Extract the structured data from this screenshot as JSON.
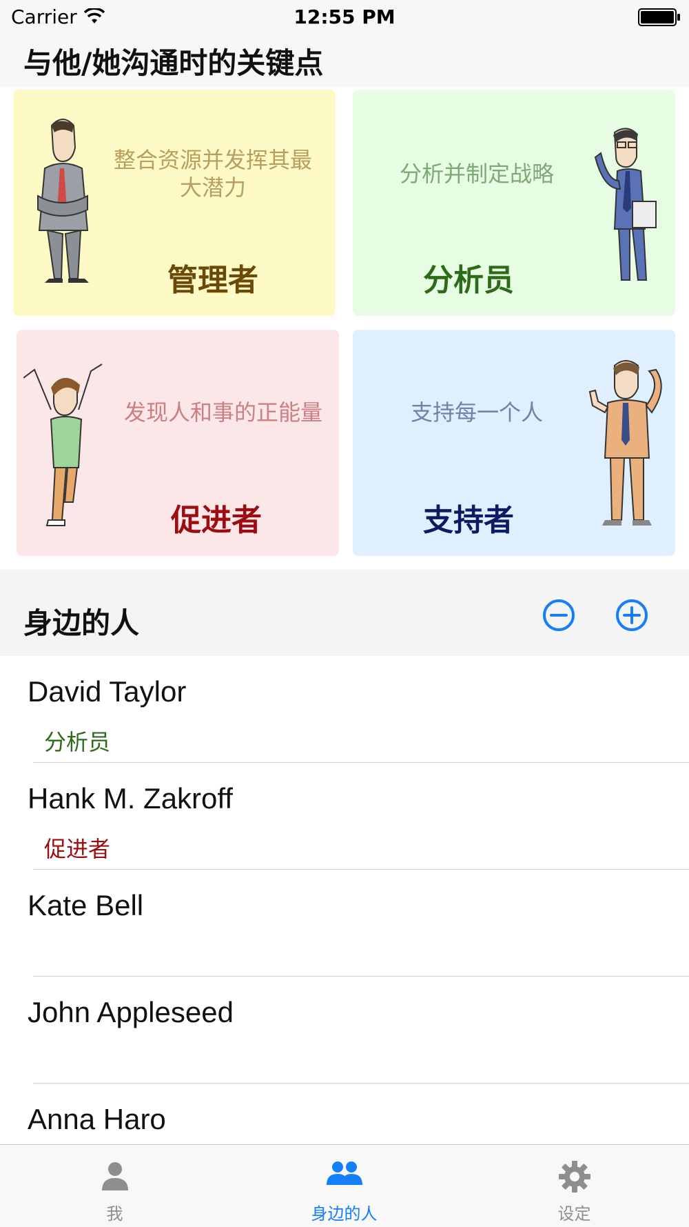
{
  "status_bar": {
    "carrier": "Carrier",
    "time": "12:55 PM"
  },
  "header": {
    "title": "与他/她沟通时的关键点"
  },
  "cards": [
    {
      "title": "管理者",
      "description": "整合资源并发挥其最大潜力",
      "bg": "#fdfac6",
      "title_color": "#6b4a07",
      "desc_color": "#b79f5f"
    },
    {
      "title": "分析员",
      "description": "分析并制定战略",
      "bg": "#e6fde3",
      "title_color": "#2f6a1a",
      "desc_color": "#7fa777"
    },
    {
      "title": "促进者",
      "description": "发现人和事的正能量",
      "bg": "#fbe7e8",
      "title_color": "#9c0d12",
      "desc_color": "#cc7f82"
    },
    {
      "title": "支持者",
      "description": "支持每一个人",
      "bg": "#dfeffd",
      "title_color": "#0d1b63",
      "desc_color": "#6f83a8"
    }
  ],
  "section": {
    "title": "身边的人",
    "remove_icon": "minus-circle-icon",
    "add_icon": "plus-circle-icon"
  },
  "contacts": [
    {
      "name": "David Taylor",
      "role": "分析员",
      "role_color": "#2f6a1a"
    },
    {
      "name": "Hank M. Zakroff",
      "role": "促进者",
      "role_color": "#9c0d12"
    },
    {
      "name": "Kate Bell",
      "role": ""
    },
    {
      "name": "John Appleseed",
      "role": ""
    },
    {
      "name": "Anna Haro",
      "role": ""
    }
  ],
  "tabs": [
    {
      "label": "我",
      "icon": "person-icon",
      "active": false
    },
    {
      "label": "身边的人",
      "icon": "people-icon",
      "active": true
    },
    {
      "label": "设定",
      "icon": "gear-icon",
      "active": false
    }
  ],
  "colors": {
    "accent": "#147efb",
    "tab_inactive": "#8e8e8e"
  }
}
